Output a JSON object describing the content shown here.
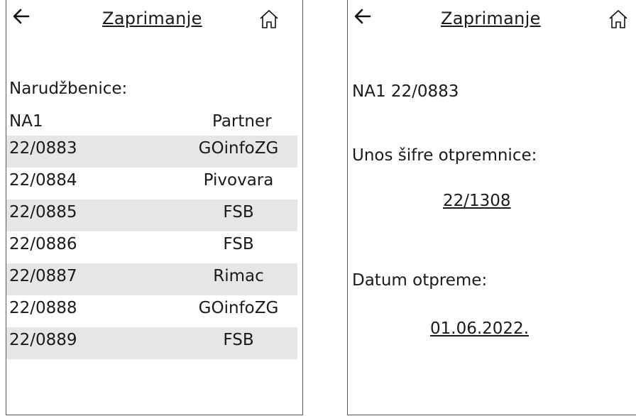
{
  "left_screen": {
    "title": "Zaprimanje",
    "section_label": "Narudžbenice:",
    "columns": [
      "NA1",
      "Partner"
    ],
    "rows": [
      {
        "order": "22/0883",
        "partner": "GOinfoZG"
      },
      {
        "order": "22/0884",
        "partner": "Pivovara"
      },
      {
        "order": "22/0885",
        "partner": "FSB"
      },
      {
        "order": "22/0886",
        "partner": "FSB"
      },
      {
        "order": "22/0887",
        "partner": "Rimac"
      },
      {
        "order": "22/0888",
        "partner": "GOinfoZG"
      },
      {
        "order": "22/0889",
        "partner": "FSB"
      }
    ]
  },
  "right_screen": {
    "title": "Zaprimanje",
    "order_ref": "NA1 22/0883",
    "delivery_code_label": "Unos šifre otpremnice:",
    "delivery_code_value": "22/1308",
    "ship_date_label": "Datum otpreme:",
    "ship_date_value": "01.06.2022."
  },
  "icons": {
    "back": "arrow-left-icon",
    "home": "home-icon"
  },
  "colors": {
    "row_shade": "#e6e6e6",
    "border": "#555555"
  }
}
